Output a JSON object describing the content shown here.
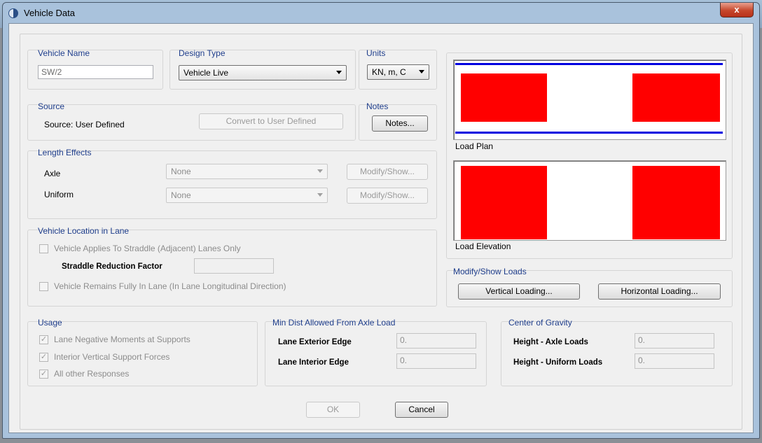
{
  "window": {
    "title": "Vehicle Data",
    "close_label": "x"
  },
  "vehicle_name": {
    "label": "Vehicle Name",
    "value": "SW/2"
  },
  "design_type": {
    "label": "Design Type",
    "value": "Vehicle Live"
  },
  "units": {
    "label": "Units",
    "value": "KN, m, C"
  },
  "source": {
    "label": "Source",
    "text": "Source: User Defined",
    "convert_button": "Convert to User Defined"
  },
  "notes": {
    "label": "Notes",
    "button": "Notes..."
  },
  "length_effects": {
    "label": "Length Effects",
    "rows": [
      {
        "label": "Axle",
        "value": "None",
        "button": "Modify/Show..."
      },
      {
        "label": "Uniform",
        "value": "None",
        "button": "Modify/Show..."
      }
    ]
  },
  "location": {
    "label": "Vehicle Location in Lane",
    "straddle_only": "Vehicle Applies To Straddle (Adjacent) Lanes Only",
    "straddle_factor_label": "Straddle Reduction Factor",
    "straddle_factor_value": "",
    "fully_in_lane": "Vehicle Remains Fully In Lane (In Lane Longitudinal Direction)"
  },
  "preview": {
    "plan_label": "Load Plan",
    "elevation_label": "Load Elevation"
  },
  "modify_loads": {
    "label": "Modify/Show Loads",
    "vertical_button": "Vertical Loading...",
    "horizontal_button": "Horizontal Loading..."
  },
  "usage": {
    "label": "Usage",
    "items": [
      {
        "label": "Lane Negative Moments at Supports",
        "checked": true
      },
      {
        "label": "Interior Vertical Support Forces",
        "checked": true
      },
      {
        "label": "All other Responses",
        "checked": true
      }
    ]
  },
  "min_dist": {
    "label": "Min Dist Allowed From Axle Load",
    "exterior_label": "Lane Exterior Edge",
    "exterior_value": "0.",
    "interior_label": "Lane Interior Edge",
    "interior_value": "0."
  },
  "cog": {
    "label": "Center of Gravity",
    "axle_label": "Height - Axle Loads",
    "axle_value": "0.",
    "uniform_label": "Height - Uniform Loads",
    "uniform_value": "0."
  },
  "footer": {
    "ok": "OK",
    "cancel": "Cancel"
  },
  "colors": {
    "load_fill": "#ff0000",
    "lane_line": "#0000e0",
    "group_label": "#1f3e8c"
  },
  "icons": {
    "check": "✓"
  }
}
